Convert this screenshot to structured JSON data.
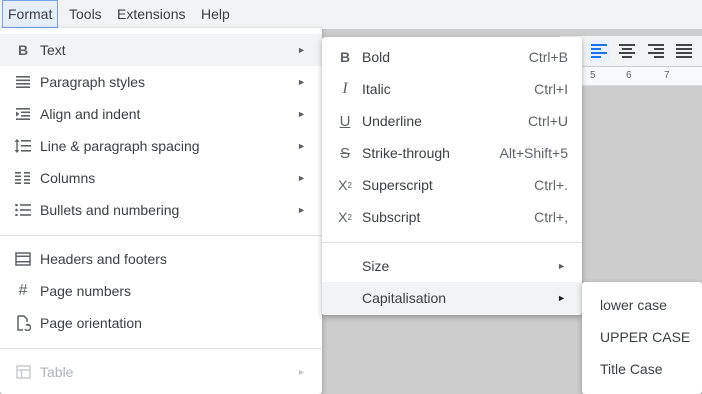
{
  "menubar": {
    "items": [
      "Format",
      "Tools",
      "Extensions",
      "Help"
    ],
    "active": "Format"
  },
  "format_menu": {
    "items": [
      {
        "label": "Text",
        "icon": "bold-icon",
        "submenu": true,
        "highlighted": true
      },
      {
        "label": "Paragraph styles",
        "icon": "paragraph-styles-icon",
        "submenu": true
      },
      {
        "label": "Align and indent",
        "icon": "indent-icon",
        "submenu": true
      },
      {
        "label": "Line & paragraph spacing",
        "icon": "line-spacing-icon",
        "submenu": true
      },
      {
        "label": "Columns",
        "icon": "columns-icon",
        "submenu": true
      },
      {
        "label": "Bullets and numbering",
        "icon": "bulleted-list-icon",
        "submenu": true
      },
      {
        "label": "Headers and footers",
        "icon": "header-footer-icon",
        "submenu": false
      },
      {
        "label": "Page numbers",
        "icon": "hash-icon",
        "submenu": false
      },
      {
        "label": "Page orientation",
        "icon": "page-orientation-icon",
        "submenu": false
      },
      {
        "label": "Table",
        "icon": "table-icon",
        "submenu": true,
        "disabled": true
      }
    ]
  },
  "text_submenu": {
    "items": [
      {
        "label": "Bold",
        "icon": "bold-icon",
        "shortcut": "Ctrl+B"
      },
      {
        "label": "Italic",
        "icon": "italic-icon",
        "shortcut": "Ctrl+I"
      },
      {
        "label": "Underline",
        "icon": "underline-icon",
        "shortcut": "Ctrl+U"
      },
      {
        "label": "Strike-through",
        "icon": "strikethrough-icon",
        "shortcut": "Alt+Shift+5"
      },
      {
        "label": "Superscript",
        "icon": "superscript-icon",
        "shortcut": "Ctrl+."
      },
      {
        "label": "Subscript",
        "icon": "subscript-icon",
        "shortcut": "Ctrl+,"
      },
      {
        "label": "Size",
        "submenu": true
      },
      {
        "label": "Capitalisation",
        "submenu": true,
        "highlighted": true
      }
    ]
  },
  "capitalisation_submenu": {
    "items": [
      "lower case",
      "UPPER CASE",
      "Title Case"
    ]
  },
  "ruler": {
    "marks": [
      "5",
      "6",
      "7"
    ]
  },
  "colors": {
    "accent": "#1a73e8",
    "menu_hover": "#f1f3f4",
    "menu_text": "#3c4043"
  }
}
